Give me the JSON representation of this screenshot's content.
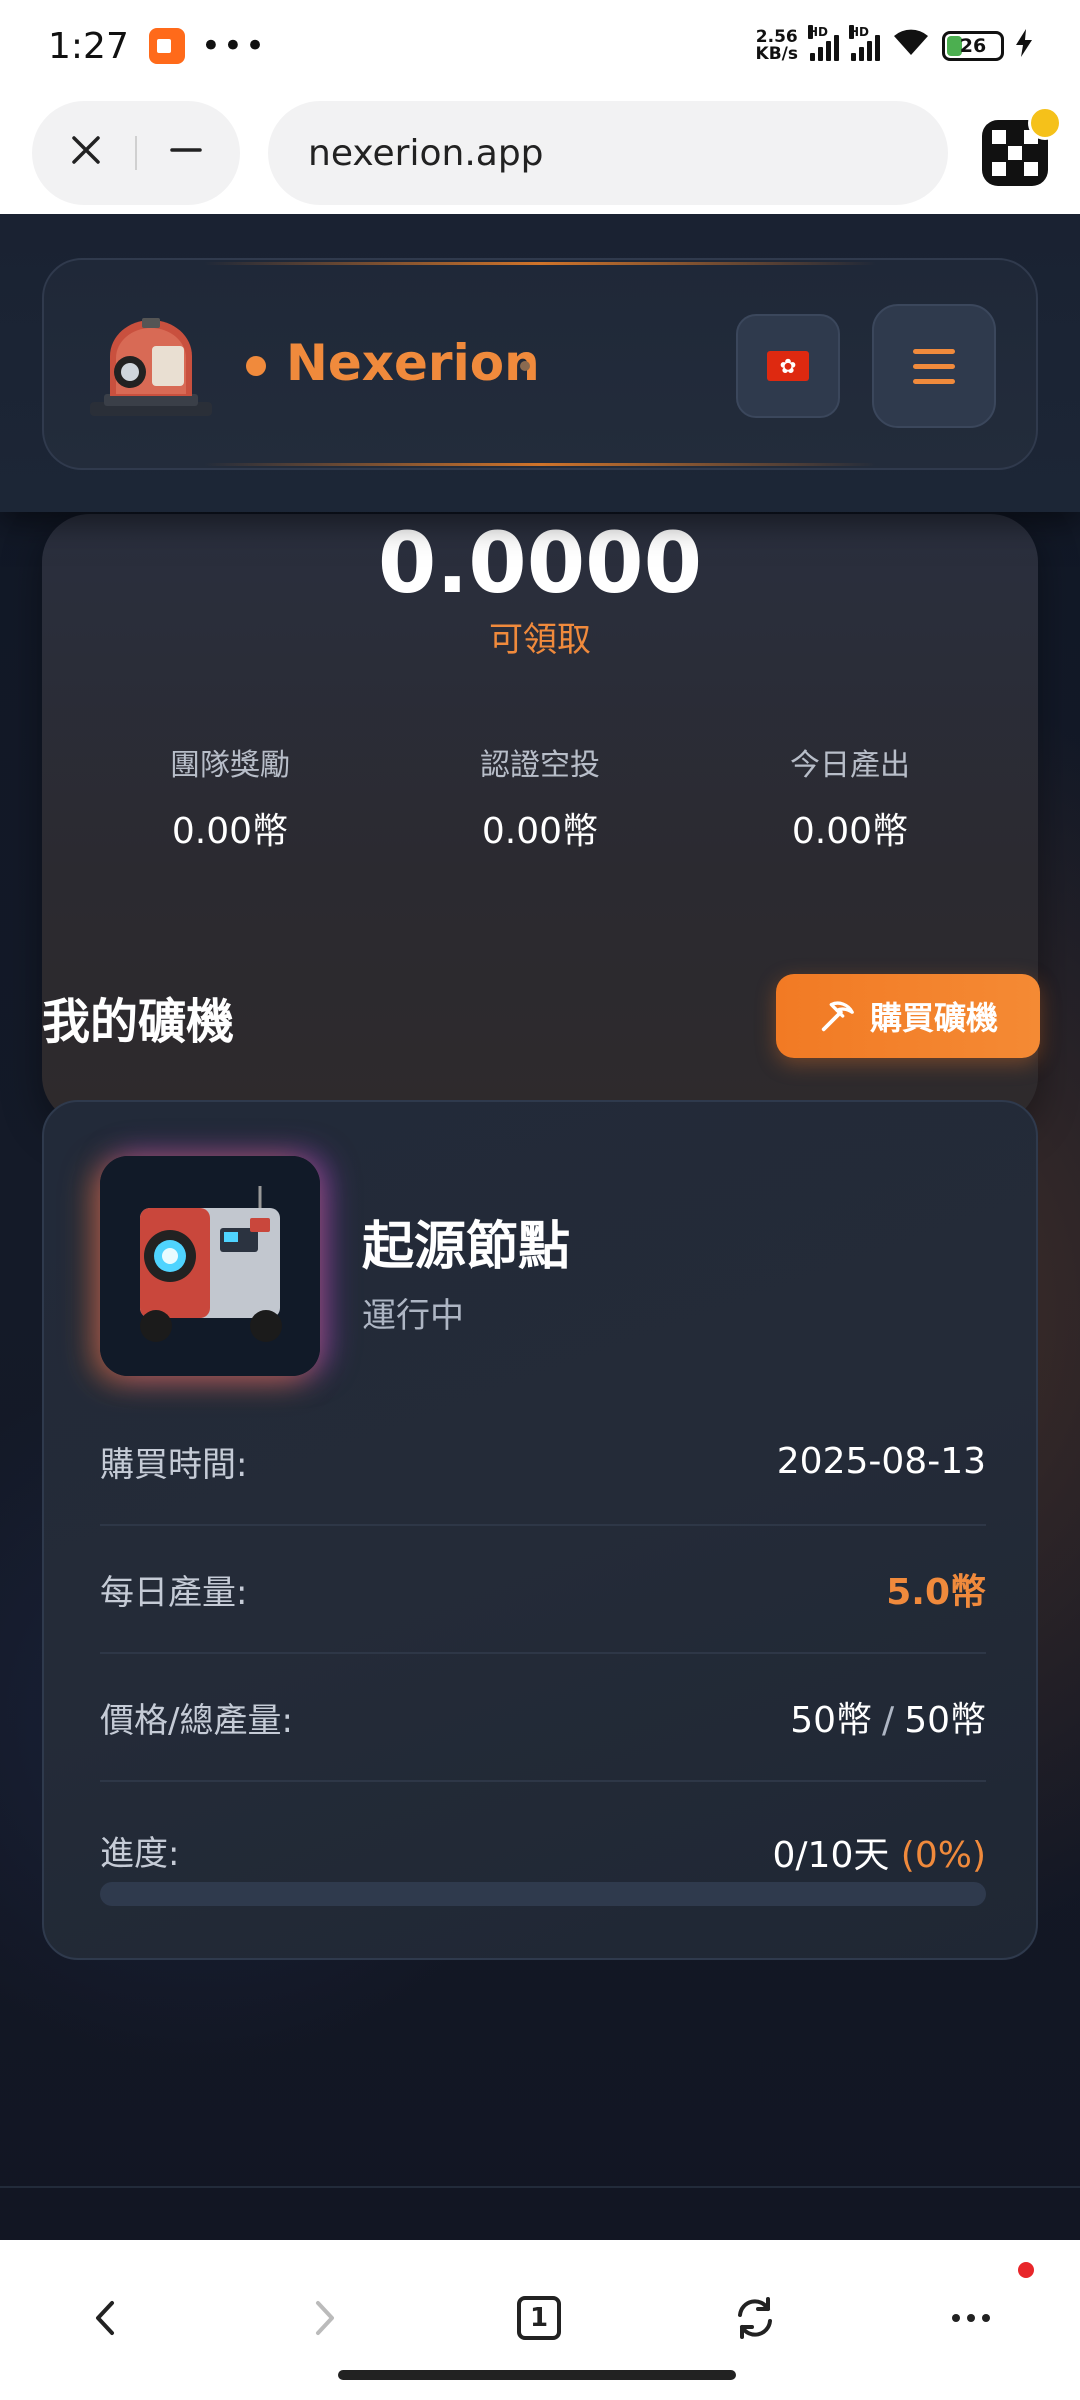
{
  "status_bar": {
    "time": "1:27",
    "dots": "•••",
    "net_speed_value": "2.56",
    "net_speed_unit": "KB/s",
    "hd_label": "HD",
    "battery": "26"
  },
  "browser": {
    "url": "nexerion.app"
  },
  "header": {
    "brand_name": "Nexerion",
    "language_flag": "🇭🇰"
  },
  "summary": {
    "balance": "0.0000",
    "claimable_label": "可領取",
    "stats": [
      {
        "label": "團隊獎勵",
        "value": "0.00幣"
      },
      {
        "label": "認證空投",
        "value": "0.00幣"
      },
      {
        "label": "今日產出",
        "value": "0.00幣"
      }
    ]
  },
  "my_miners": {
    "title": "我的礦機",
    "buy_button_label": "購買礦機"
  },
  "miner": {
    "name": "起源節點",
    "status": "運行中",
    "rows": {
      "purchase_time": {
        "label": "購買時間:",
        "value": "2025-08-13"
      },
      "daily_output": {
        "label": "每日產量:",
        "value": "5.0幣"
      },
      "price_total": {
        "label": "價格/總產量:",
        "price": "50幣",
        "separator": "/",
        "total": "50幣"
      },
      "progress": {
        "label": "進度:",
        "days": "0/10天",
        "percent": "(0%)"
      }
    },
    "progress_fraction": 0
  },
  "bottom_nav": {
    "tab_count": "1"
  },
  "colors": {
    "accent": "#f08a3c",
    "background": "#0f1522",
    "card": "#232b39"
  }
}
